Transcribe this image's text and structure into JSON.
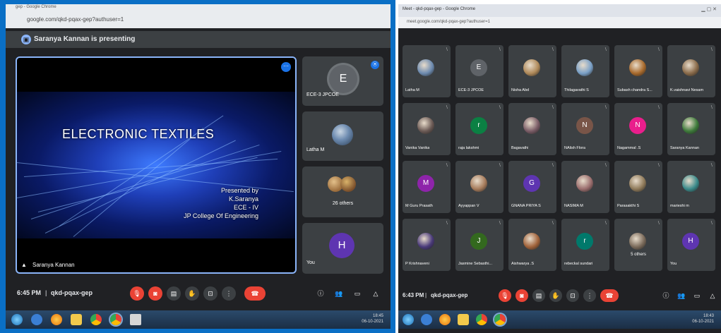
{
  "left": {
    "browser": {
      "tab_title": "gep - Google Chrome",
      "url": "google.com/qkd-pqax-gep?authuser=1"
    },
    "presenting_banner": "Saranya Kannan is presenting",
    "slide": {
      "title": "ELECTRONIC TEXTILES",
      "presented_by": "Presented by",
      "presenter": "K.Saranya",
      "dept": "ECE - IV",
      "college": "JP College Of Engineering"
    },
    "stage_name": "Saranya Kannan",
    "side_tiles": [
      {
        "name": "ECE-3 JPCOE",
        "initial": "E",
        "avatar_color": "#5f6368"
      },
      {
        "name": "Latha M"
      },
      {
        "name": "26 others"
      },
      {
        "name": "You",
        "initial": "H",
        "avatar_color": "#5e35b1"
      }
    ],
    "time": "6:45 PM",
    "meeting_code": "qkd-pqax-gep",
    "tray_time": "18:45",
    "tray_date": "06-10-2021"
  },
  "right": {
    "window_title": "Meet - qkd-pqax-gep - Google Chrome",
    "url": "meet.google.com/qkd-pqax-gep?authuser=1",
    "grid": [
      {
        "name": "Latha M",
        "initial": "",
        "color": "#6d8bb0"
      },
      {
        "name": "ECE-3 JPCOE",
        "initial": "E",
        "color": "#5f6368"
      },
      {
        "name": "Nisha Abd",
        "initial": "",
        "color": "#b08a5a"
      },
      {
        "name": "Thilagavathi S",
        "initial": "",
        "color": "#7aa0c7"
      },
      {
        "name": "Subash chandra S...",
        "initial": "",
        "color": "#a86a2c"
      },
      {
        "name": "K.vaishnavi Nesam",
        "initial": "",
        "color": "#8a6b4a"
      },
      {
        "name": "Vanika Vanika",
        "initial": "",
        "color": "#6b5a55"
      },
      {
        "name": "raja lakshmi",
        "initial": "r",
        "color": "#0b8043"
      },
      {
        "name": "Bagavathi",
        "initial": "",
        "color": "#7a5c66"
      },
      {
        "name": "NAlish Flora",
        "initial": "N",
        "color": "#795548"
      },
      {
        "name": "Nagammal .S",
        "initial": "N",
        "color": "#e91e8c"
      },
      {
        "name": "Saranya Kannan",
        "initial": "",
        "color": "#3d7a3a"
      },
      {
        "name": "M Guru Prasath",
        "initial": "M",
        "color": "#8e24aa"
      },
      {
        "name": "Ayyappan V",
        "initial": "",
        "color": "#a67b5b"
      },
      {
        "name": "GNANA PRIYA S",
        "initial": "G",
        "color": "#5e35b1"
      },
      {
        "name": "NASIMA M",
        "initial": "",
        "color": "#9a6d6d"
      },
      {
        "name": "Parasakthi S",
        "initial": "",
        "color": "#8f7a5a"
      },
      {
        "name": "marieshi m",
        "initial": "",
        "color": "#3a8a8a"
      },
      {
        "name": "P Krishnaveni",
        "initial": "",
        "color": "#4a3a7a"
      },
      {
        "name": "Jasmine Sebasthi...",
        "initial": "J",
        "color": "#33691e"
      },
      {
        "name": "Aishwarya .S",
        "initial": "",
        "color": "#a0623a"
      },
      {
        "name": "rebeckal sundari",
        "initial": "r",
        "color": "#00796b"
      },
      {
        "name": "5 others",
        "initial": "",
        "color": "#7a6a5a"
      },
      {
        "name": "You",
        "initial": "H",
        "color": "#5e35b1"
      }
    ],
    "time": "6:43 PM",
    "meeting_code": "qkd-pqax-gep",
    "tray_time": "18:43",
    "tray_date": "06-10-2021"
  }
}
